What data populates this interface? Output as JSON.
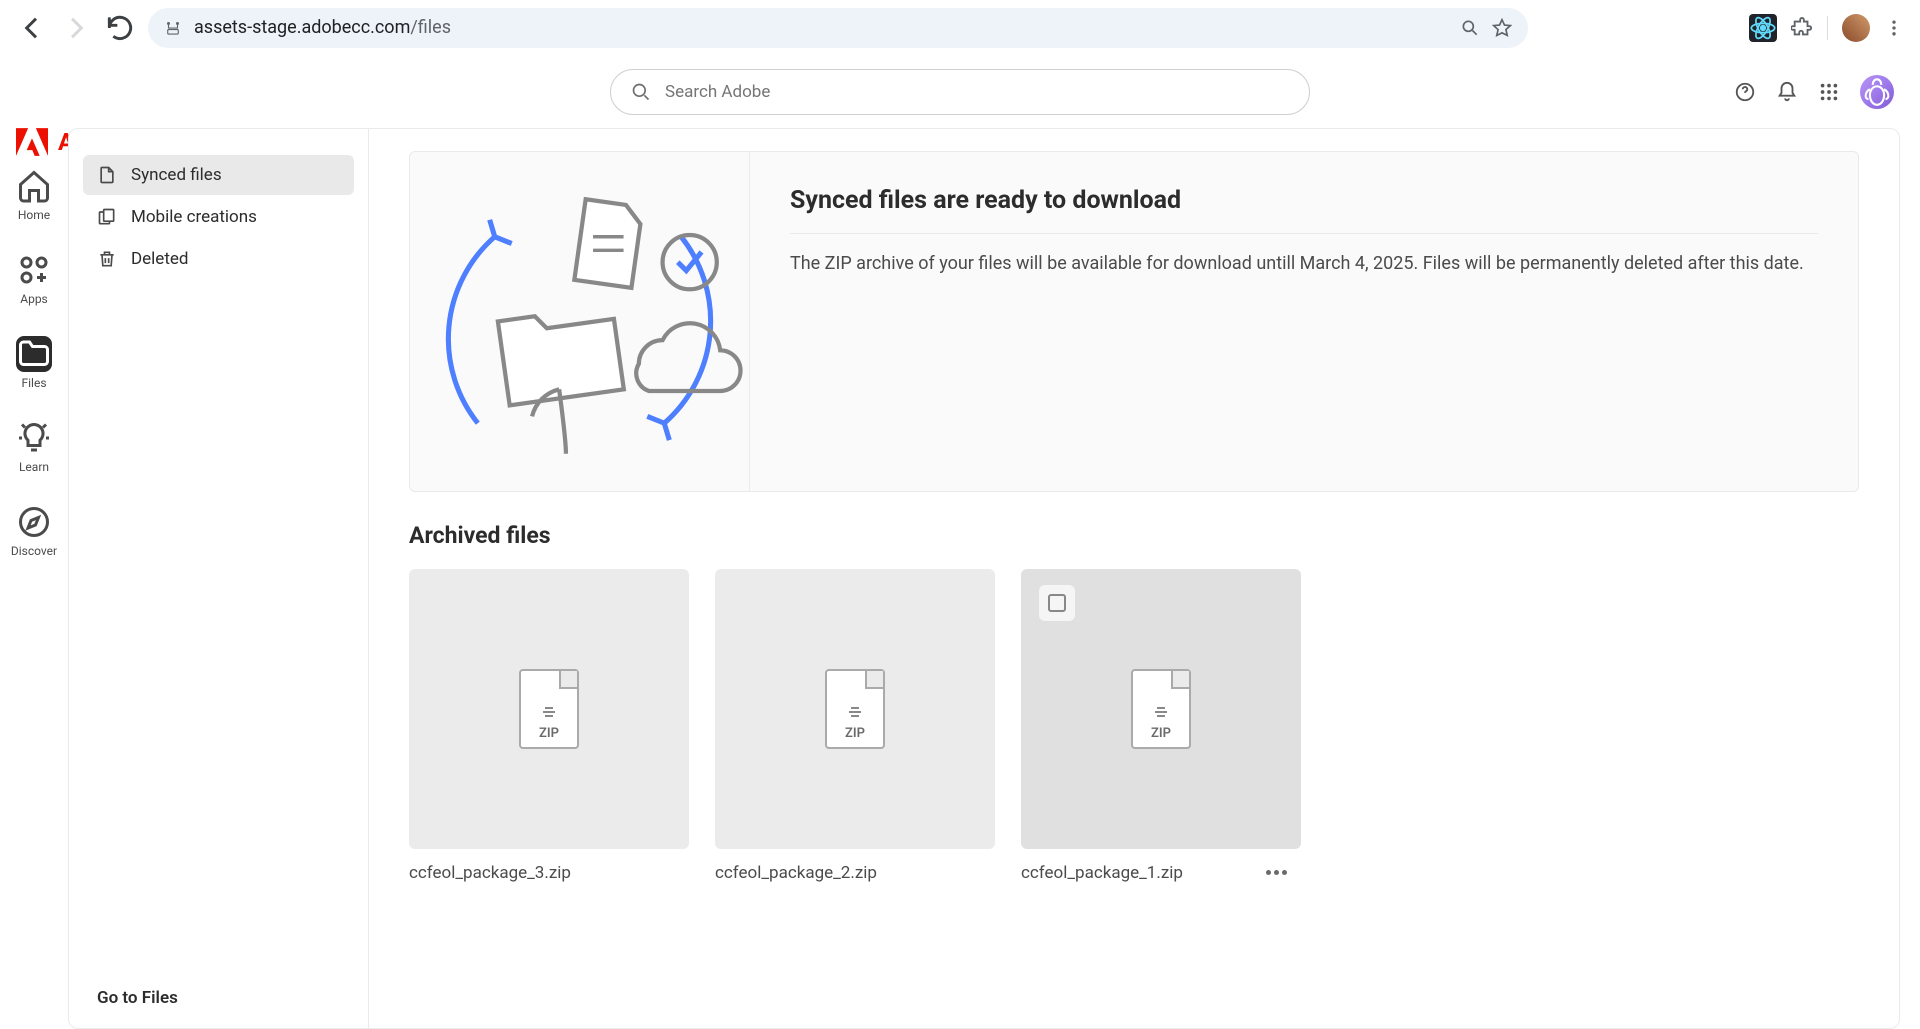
{
  "browser": {
    "url_host": "assets-stage.adobecc.com",
    "url_path": "/files"
  },
  "brand": {
    "name": "Adobe"
  },
  "search": {
    "placeholder": "Search Adobe"
  },
  "rail": {
    "items": [
      {
        "label": "Home",
        "active": false
      },
      {
        "label": "Apps",
        "active": false
      },
      {
        "label": "Files",
        "active": true
      },
      {
        "label": "Learn",
        "active": false
      },
      {
        "label": "Discover",
        "active": false
      }
    ]
  },
  "sidebar": {
    "items": [
      {
        "label": "Synced files",
        "active": true
      },
      {
        "label": "Mobile creations",
        "active": false
      },
      {
        "label": "Deleted",
        "active": false
      }
    ],
    "go_files": "Go to Files"
  },
  "banner": {
    "title": "Synced files are ready to download",
    "body": "The ZIP archive of your files will be available for download untill March 4, 2025. Files will be permanently deleted after this date."
  },
  "archived": {
    "title": "Archived files",
    "zip_label": "ZIP",
    "files": [
      {
        "name": "ccfeol_package_3.zip",
        "hover": false
      },
      {
        "name": "ccfeol_package_2.zip",
        "hover": false
      },
      {
        "name": "ccfeol_package_1.zip",
        "hover": true
      }
    ]
  }
}
